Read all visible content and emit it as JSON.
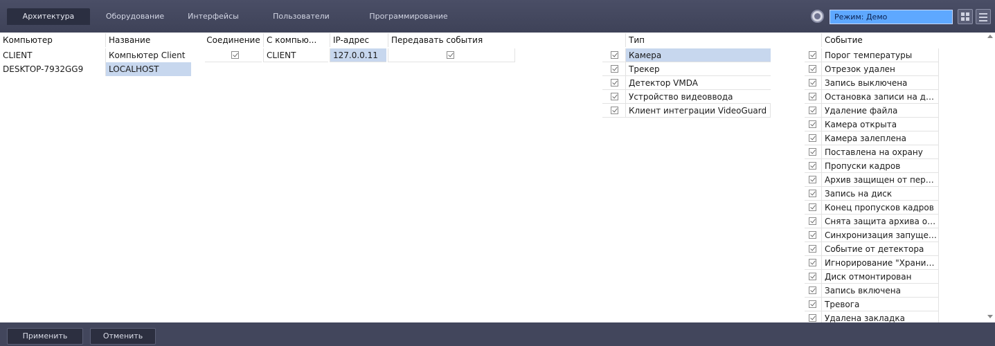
{
  "tabs": [
    {
      "label": "Архитектура",
      "active": true
    },
    {
      "label": "Оборудование",
      "active": false
    },
    {
      "label": "Интерфейсы",
      "active": false
    },
    {
      "label": "Пользователи",
      "active": false
    },
    {
      "label": "Программирование",
      "active": false
    }
  ],
  "mode": {
    "value": "Режим: Демо",
    "icon": "mode-icon"
  },
  "toolbar": {
    "grid_icon": "grid-layout-icon",
    "menu_icon": "menu-icon"
  },
  "computers_table": {
    "headers": {
      "computer": "Компьютер",
      "name": "Название"
    },
    "rows": [
      {
        "computer": "CLIENT",
        "name": "Компьютер Client",
        "selected": false
      },
      {
        "computer": "DESKTOP-7932GG9",
        "name": "LOCALHOST",
        "selected": true
      }
    ]
  },
  "connections_table": {
    "headers": {
      "connection": "Соединение",
      "from_computer": "С компью...",
      "ip": "IP-адрес",
      "send_events": "Передавать события"
    },
    "rows": [
      {
        "connection": true,
        "from_computer": "CLIENT",
        "ip": "127.0.0.11",
        "send_events": true
      }
    ]
  },
  "types_table": {
    "header": "Тип",
    "rows": [
      {
        "label": "Камера",
        "checked": true,
        "selected": true
      },
      {
        "label": "Трекер",
        "checked": true,
        "selected": false
      },
      {
        "label": "Детектор VMDA",
        "checked": true,
        "selected": false
      },
      {
        "label": "Устройство видеоввода",
        "checked": true,
        "selected": false
      },
      {
        "label": "Клиент интеграции VideoGuard",
        "checked": true,
        "selected": false
      }
    ]
  },
  "events_table": {
    "header": "Событие",
    "rows": [
      {
        "label": "Порог температуры",
        "checked": true
      },
      {
        "label": "Отрезок удален",
        "checked": true
      },
      {
        "label": "Запись выключена",
        "checked": true
      },
      {
        "label": "Остановка записи на диск",
        "checked": true
      },
      {
        "label": "Удаление файла",
        "checked": true
      },
      {
        "label": "Камера открыта",
        "checked": true
      },
      {
        "label": "Камера залеплена",
        "checked": true
      },
      {
        "label": "Поставлена на охрану",
        "checked": true
      },
      {
        "label": "Пропуски кадров",
        "checked": true
      },
      {
        "label": "Архив защищен от переза..",
        "checked": true
      },
      {
        "label": "Запись на диск",
        "checked": true
      },
      {
        "label": "Конец пропусков кадров",
        "checked": true
      },
      {
        "label": "Снята защита архива от пе..",
        "checked": true
      },
      {
        "label": "Синхронизация запущена",
        "checked": true
      },
      {
        "label": "Событие от детектора",
        "checked": true
      },
      {
        "label": "Игнорирование \"Хранить ..",
        "checked": true
      },
      {
        "label": "Диск отмонтирован",
        "checked": true
      },
      {
        "label": "Запись включена",
        "checked": true
      },
      {
        "label": "Тревога",
        "checked": true
      },
      {
        "label": "Удалена закладка",
        "checked": true
      }
    ]
  },
  "bottom": {
    "apply_label": "Применить",
    "cancel_label": "Отменить"
  }
}
